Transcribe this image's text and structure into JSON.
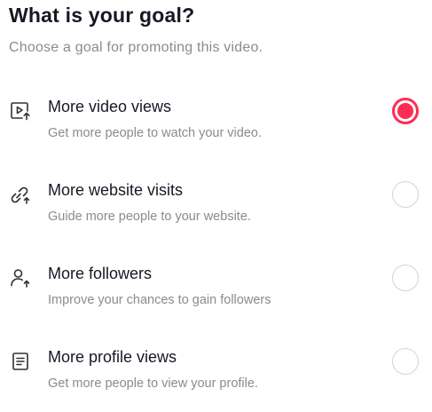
{
  "header": {
    "title": "What is your goal?",
    "subtitle": "Choose a goal for promoting this video."
  },
  "accent_color": "#fe2c55",
  "goals": [
    {
      "icon": "video-views-icon",
      "label": "More video views",
      "description": "Get more people to watch your video.",
      "selected": true
    },
    {
      "icon": "link-icon",
      "label": "More website visits",
      "description": "Guide more people to your website.",
      "selected": false
    },
    {
      "icon": "follower-icon",
      "label": "More followers",
      "description": "Improve your chances to gain followers",
      "selected": false
    },
    {
      "icon": "document-icon",
      "label": "More profile views",
      "description": "Get more people to view your profile.",
      "selected": false
    }
  ]
}
